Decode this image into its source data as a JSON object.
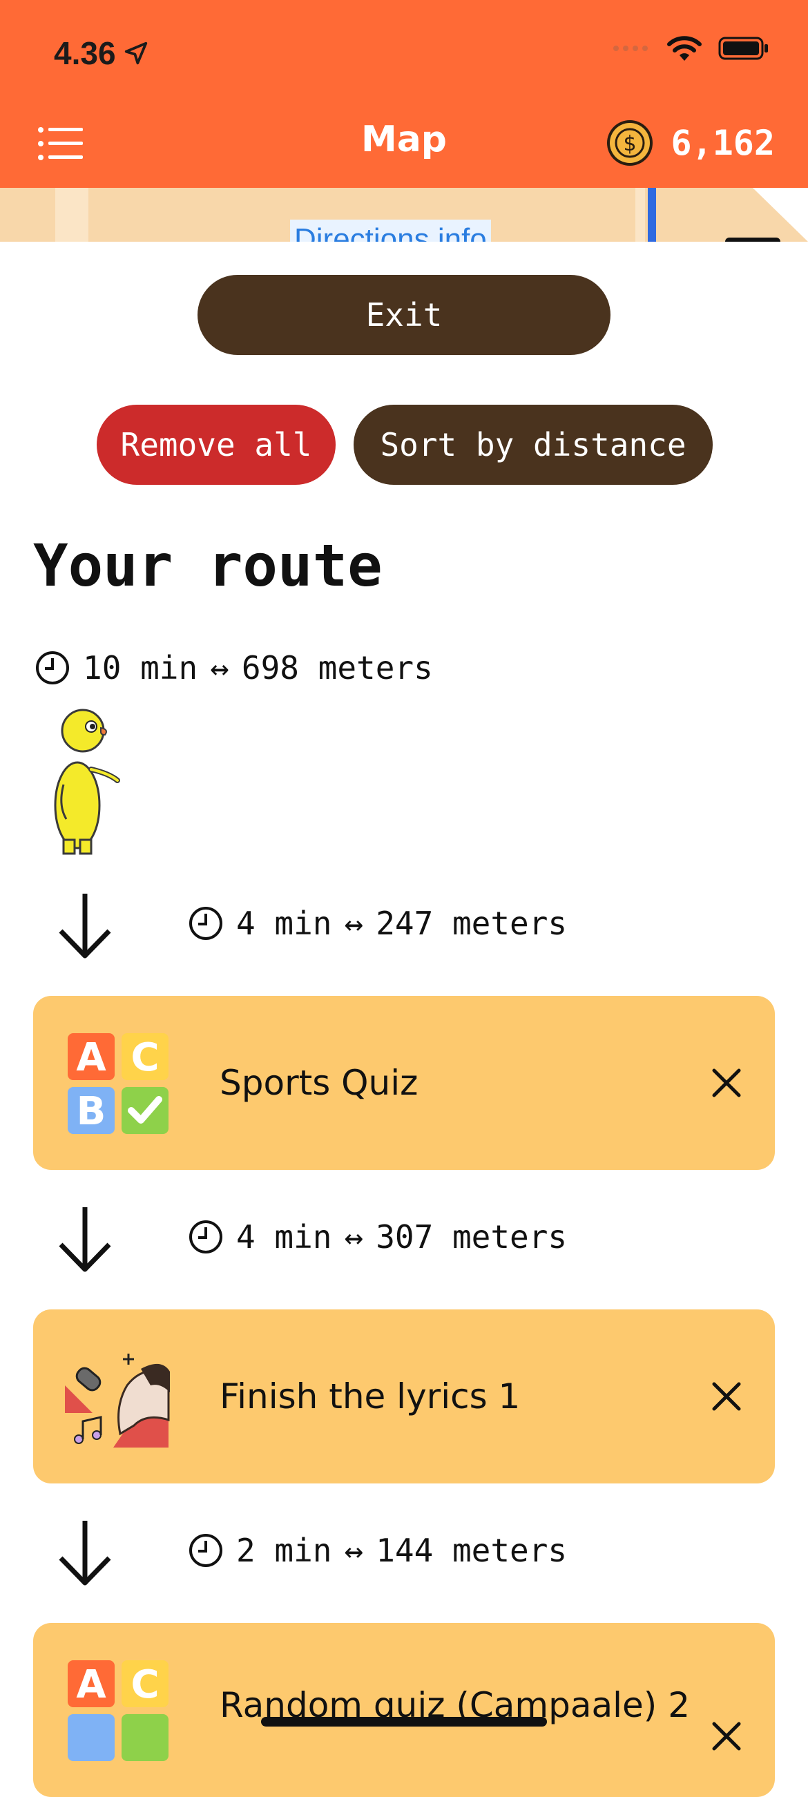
{
  "status_bar": {
    "time": "4.36"
  },
  "header": {
    "title": "Map",
    "coins": "6,162",
    "coin_symbol": "$"
  },
  "map": {
    "directions_label": "Directions info"
  },
  "buttons": {
    "exit": "Exit",
    "remove_all": "Remove all",
    "sort": "Sort by distance"
  },
  "route": {
    "title": "Your route",
    "total": {
      "time": "10 min",
      "distance": "698 meters"
    },
    "legs": [
      {
        "time": "4 min",
        "distance": "247 meters"
      },
      {
        "time": "4 min",
        "distance": "307 meters"
      },
      {
        "time": "2 min",
        "distance": "144 meters"
      }
    ],
    "items": [
      {
        "name": "Sports Quiz",
        "icon": "abc-quiz-icon"
      },
      {
        "name": "Finish the lyrics 1",
        "icon": "singer-icon"
      },
      {
        "name": "Random quiz (Campaale) 2",
        "icon": "abc-quiz-icon"
      }
    ]
  },
  "separator": "↔",
  "colors": {
    "accent": "#ff6a36",
    "card": "#fdc96e",
    "dark_button": "#4a331e",
    "danger": "#cc2b2b"
  }
}
